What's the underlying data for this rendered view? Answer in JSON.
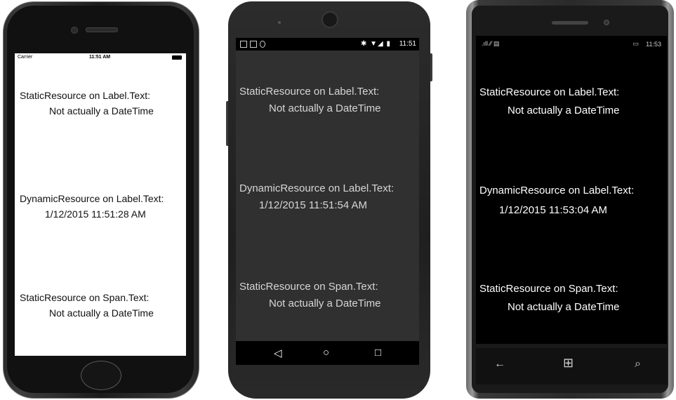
{
  "devices": {
    "ios": {
      "status": {
        "carrier": "Carrier",
        "time": "11:51 AM"
      },
      "items": [
        {
          "label": "StaticResource on Label.Text:",
          "value": "Not actually a DateTime"
        },
        {
          "label": "DynamicResource on Label.Text:",
          "value": "1/12/2015 11:51:28 AM"
        },
        {
          "label": "StaticResource on Span.Text:",
          "value": "Not actually a DateTime"
        }
      ]
    },
    "android": {
      "status": {
        "time": "11:51"
      },
      "items": [
        {
          "label": "StaticResource on Label.Text:",
          "value": "Not actually a DateTime"
        },
        {
          "label": "DynamicResource on Label.Text:",
          "value": "1/12/2015 11:51:54 AM"
        },
        {
          "label": "StaticResource on Span.Text:",
          "value": "Not actually a DateTime"
        }
      ],
      "nav_icons": [
        "back-icon",
        "home-icon",
        "recents-icon"
      ]
    },
    "windows": {
      "status": {
        "time": "11:53"
      },
      "items": [
        {
          "label": "StaticResource on Label.Text:",
          "value": "Not actually a DateTime"
        },
        {
          "label": "DynamicResource on Label.Text:",
          "value": "1/12/2015 11:53:04 AM"
        },
        {
          "label": "StaticResource on Span.Text:",
          "value": "Not actually a DateTime"
        }
      ],
      "nav_icons": [
        "back-arrow-icon",
        "windows-logo-icon",
        "search-icon"
      ]
    }
  },
  "colors": {
    "ios_screen": "#ffffff",
    "android_screen": "#303030",
    "windows_screen": "#000000"
  }
}
